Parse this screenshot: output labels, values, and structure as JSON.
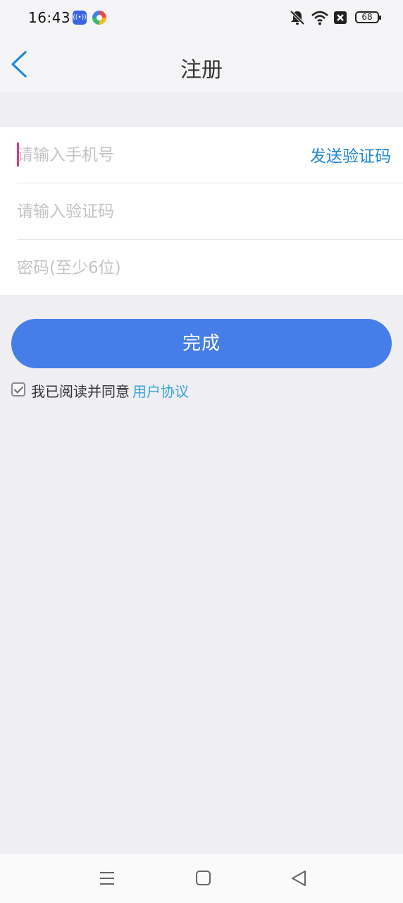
{
  "status_bar": {
    "time": "16:43",
    "battery": "68",
    "icons": [
      "nfc-app-icon",
      "colorful-app-icon",
      "mute-icon",
      "wifi-icon",
      "sim-x-icon",
      "battery-icon"
    ]
  },
  "header": {
    "title": "注册",
    "back_icon": "chevron-left-icon"
  },
  "form": {
    "phone_placeholder": "请输入手机号",
    "phone_value": "",
    "send_code_label": "发送验证码",
    "code_placeholder": "请输入验证码",
    "code_value": "",
    "password_placeholder": "密码(至少6位)",
    "password_value": ""
  },
  "done_label": "完成",
  "agreement": {
    "checked": true,
    "text": "我已阅读并同意",
    "link": "用户协议"
  },
  "colors": {
    "accent": "#457ee8",
    "link": "#1e88d8",
    "caret": "#e2377a",
    "background": "#eeeef3"
  },
  "nav_bar": {
    "icons": [
      "menu-icon",
      "home-icon",
      "back-triangle-icon"
    ]
  }
}
